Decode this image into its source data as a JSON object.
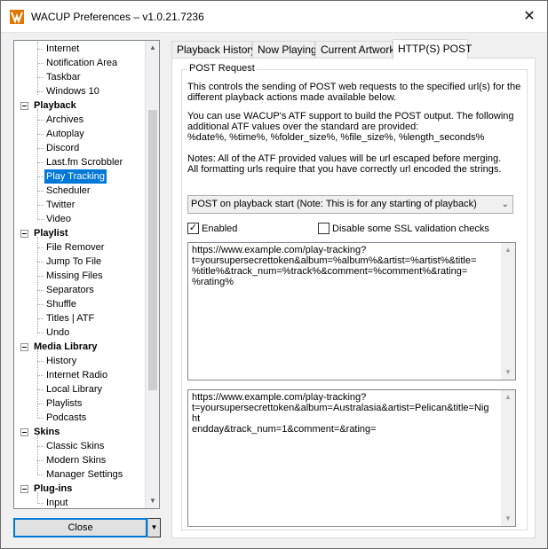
{
  "window": {
    "title": "WACUP Preferences – v1.0.21.7236",
    "close_glyph": "✕",
    "app_icon": "wacup-logo-icon"
  },
  "tree": {
    "items": [
      {
        "type": "child",
        "label": "Internet"
      },
      {
        "type": "child",
        "label": "Notification Area"
      },
      {
        "type": "child",
        "label": "Taskbar"
      },
      {
        "type": "child",
        "label": "Windows 10"
      },
      {
        "type": "cat",
        "label": "Playback"
      },
      {
        "type": "child",
        "label": "Archives"
      },
      {
        "type": "child",
        "label": "Autoplay"
      },
      {
        "type": "child",
        "label": "Discord"
      },
      {
        "type": "child",
        "label": "Last.fm Scrobbler"
      },
      {
        "type": "child",
        "label": "Play Tracking",
        "selected": true
      },
      {
        "type": "child",
        "label": "Scheduler"
      },
      {
        "type": "child",
        "label": "Twitter"
      },
      {
        "type": "child",
        "label": "Video"
      },
      {
        "type": "cat",
        "label": "Playlist"
      },
      {
        "type": "child",
        "label": "File Remover"
      },
      {
        "type": "child",
        "label": "Jump To File"
      },
      {
        "type": "child",
        "label": "Missing Files"
      },
      {
        "type": "child",
        "label": "Separators"
      },
      {
        "type": "child",
        "label": "Shuffle"
      },
      {
        "type": "child",
        "label": "Titles | ATF"
      },
      {
        "type": "child",
        "label": "Undo"
      },
      {
        "type": "cat",
        "label": "Media Library"
      },
      {
        "type": "child",
        "label": "History"
      },
      {
        "type": "child",
        "label": "Internet Radio"
      },
      {
        "type": "child",
        "label": "Local Library"
      },
      {
        "type": "child",
        "label": "Playlists"
      },
      {
        "type": "child",
        "label": "Podcasts"
      },
      {
        "type": "cat",
        "label": "Skins"
      },
      {
        "type": "child",
        "label": "Classic Skins"
      },
      {
        "type": "child",
        "label": "Modern Skins"
      },
      {
        "type": "child",
        "label": "Manager Settings"
      },
      {
        "type": "cat",
        "label": "Plug-ins"
      },
      {
        "type": "child",
        "label": "Input"
      }
    ]
  },
  "buttons": {
    "close_label": "Close",
    "close_drop_glyph": "▼"
  },
  "tabs": [
    {
      "label": "Playback History",
      "active": false
    },
    {
      "label": "Now Playing",
      "active": false
    },
    {
      "label": "Current Artwork",
      "active": false
    },
    {
      "label": "HTTP(S) POST",
      "active": true
    }
  ],
  "post": {
    "group_title": "POST Request",
    "para1_line1": "This controls the sending of POST web requests to the specified url(s) for the",
    "para1_line2": "different playback actions made available below.",
    "para2_line1": "You can use WACUP's ATF support to build the POST output. The following",
    "para2_line2": "additional ATF values over the standard are provided:",
    "para2_line3": "%date%, %time%, %folder_size%, %file_size%, %length_seconds%",
    "para3_line1": "Notes: All of the ATF provided values will be url escaped before merging.",
    "para3_line2": "All formatting urls require that you have correctly url encoded the strings.",
    "dropdown_value": "POST on playback start (Note: This is for any starting of playback)",
    "enabled_label": "Enabled",
    "enabled_checked": true,
    "ssl_label": "Disable some SSL validation checks",
    "ssl_checked": false,
    "template_value": "https://www.example.com/play-tracking?\nt=yoursupersecrettoken&album=%album%&artist=%artist%&title=\n%title%&track_num=%track%&comment=%comment%&rating=\n%rating%",
    "preview_value": "https://www.example.com/play-tracking?\nt=yoursupersecrettoken&album=Australasia&artist=Pelican&title=Night\nendday&track_num=1&comment=&rating="
  }
}
